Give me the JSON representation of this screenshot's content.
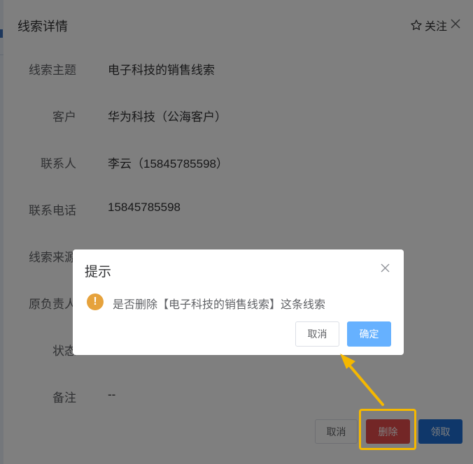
{
  "panel": {
    "title": "线索详情",
    "follow_label": "关注",
    "fields": [
      {
        "label": "线索主题",
        "value": "电子科技的销售线索"
      },
      {
        "label": "客户",
        "value": "华为科技（公海客户）"
      },
      {
        "label": "联系人",
        "value": "李云（15845785598）"
      },
      {
        "label": "联系电话",
        "value": "15845785598"
      },
      {
        "label": "线索来源",
        "value": ""
      },
      {
        "label": "原负责人",
        "value": ""
      },
      {
        "label": "状态",
        "value": ""
      },
      {
        "label": "备注",
        "value": "--"
      }
    ],
    "buttons": {
      "cancel": "取消",
      "delete": "删除",
      "claim": "领取"
    }
  },
  "dialog": {
    "title": "提示",
    "message": "是否删除【电子科技的销售线索】这条线索",
    "cancel_label": "取消",
    "confirm_label": "确定",
    "warning_icon": "!"
  },
  "colors": {
    "accent": "#1f6ed4",
    "danger": "#e74c4c",
    "warning": "#e6a23c",
    "confirm": "#66b1ff",
    "annotation": "#f5b800"
  }
}
